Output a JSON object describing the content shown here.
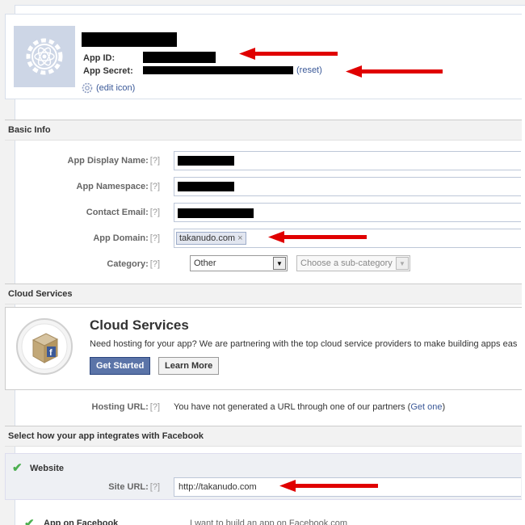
{
  "app": {
    "app_id_label": "App ID:",
    "app_secret_label": "App Secret:",
    "reset_link": "(reset)",
    "edit_icon_link": "(edit icon)"
  },
  "sections": {
    "basic_info": "Basic Info",
    "cloud_services": "Cloud Services",
    "integration": "Select how your app integrates with Facebook"
  },
  "help_marker": "[?]",
  "basic_info": {
    "display_name_label": "App Display Name:",
    "namespace_label": "App Namespace:",
    "contact_email_label": "Contact Email:",
    "app_domain_label": "App Domain:",
    "app_domain_token": "takanudo.com",
    "token_remove": "×",
    "category_label": "Category:",
    "category_value": "Other",
    "subcategory_placeholder": "Choose a sub-category"
  },
  "cloud": {
    "title": "Cloud Services",
    "description": "Need hosting for your app? We are partnering with the top cloud service providers to make building apps eas",
    "get_started": "Get Started",
    "learn_more": "Learn More",
    "hosting_label": "Hosting URL:",
    "hosting_text": "You have not generated a URL through one of our partners (",
    "hosting_link": "Get one",
    "hosting_text_end": ")"
  },
  "integration": {
    "website_title": "Website",
    "site_url_label": "Site URL:",
    "site_url_value": "http://takanudo.com",
    "app_on_facebook_title": "App on Facebook",
    "app_on_facebook_desc": "I want to build an app on Facebook.com"
  },
  "colors": {
    "link": "#3b5998",
    "annotation_arrow": "#e00000",
    "primary_button": "#5b74a8"
  }
}
